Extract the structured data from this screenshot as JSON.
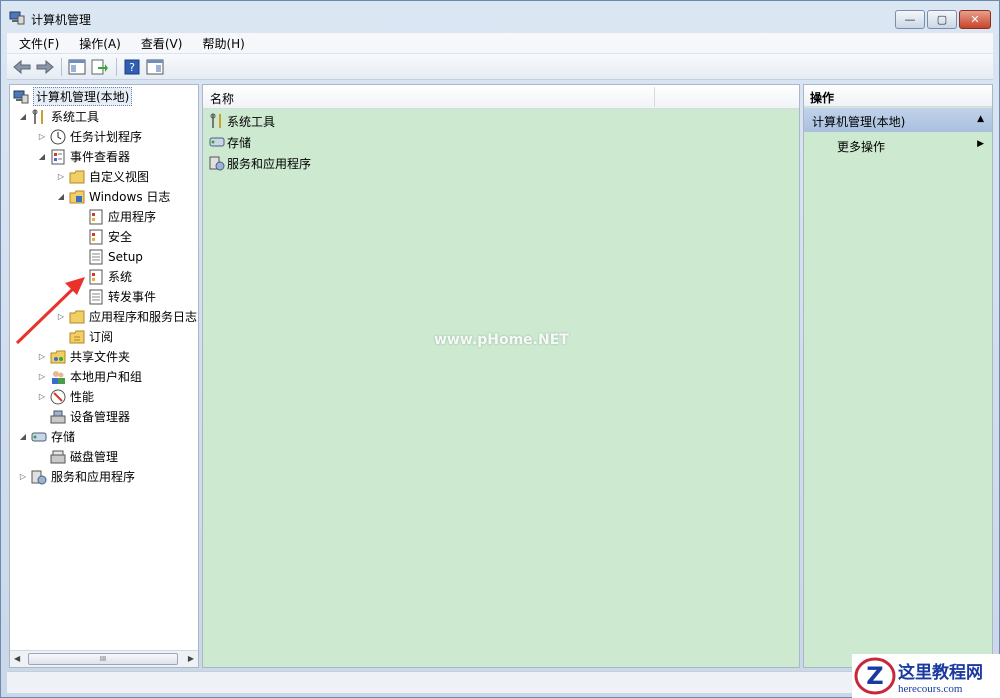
{
  "window": {
    "title": "计算机管理",
    "controls": {
      "minimize": "—",
      "maximize": "▢",
      "close": "✕"
    }
  },
  "menubar": {
    "items": [
      {
        "label": "文件(F)"
      },
      {
        "label": "操作(A)"
      },
      {
        "label": "查看(V)"
      },
      {
        "label": "帮助(H)"
      }
    ]
  },
  "toolbar": {
    "buttons": [
      "back-icon",
      "forward-icon",
      "show-hide-tree-icon",
      "export-list-icon",
      "help-icon",
      "show-hide-action-pane-icon"
    ]
  },
  "tree": {
    "root": "计算机管理(本地)",
    "items": [
      {
        "label": "系统工具"
      },
      {
        "label": "任务计划程序"
      },
      {
        "label": "事件查看器"
      },
      {
        "label": "自定义视图"
      },
      {
        "label": "Windows 日志"
      },
      {
        "label": "应用程序"
      },
      {
        "label": "安全"
      },
      {
        "label": "Setup"
      },
      {
        "label": "系统"
      },
      {
        "label": "转发事件"
      },
      {
        "label": "应用程序和服务日志"
      },
      {
        "label": "订阅"
      },
      {
        "label": "共享文件夹"
      },
      {
        "label": "本地用户和组"
      },
      {
        "label": "性能"
      },
      {
        "label": "设备管理器"
      },
      {
        "label": "存储"
      },
      {
        "label": "磁盘管理"
      },
      {
        "label": "服务和应用程序"
      }
    ],
    "scroll_thumb": "III"
  },
  "list": {
    "column_name": "名称",
    "items": [
      {
        "label": "系统工具"
      },
      {
        "label": "存储"
      },
      {
        "label": "服务和应用程序"
      }
    ],
    "watermark": "www.pHome.NET"
  },
  "actions": {
    "title": "操作",
    "group": "计算机管理(本地)",
    "more": "更多操作"
  },
  "logo": {
    "cn": "这里教程网",
    "en": "herecours.com"
  },
  "colors": {
    "pane_green": "#cde9d0",
    "annotation_red": "#e8322a"
  }
}
